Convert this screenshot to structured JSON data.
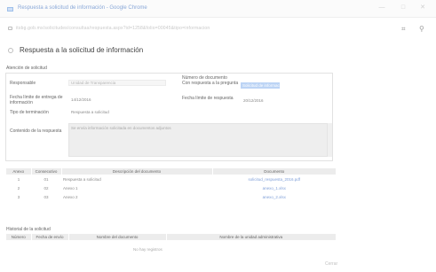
{
  "window": {
    "title": "Respuesta a solicitud de información - Google Chrome",
    "minimize_glyph": "—",
    "maximize_glyph": "□",
    "close_glyph": "✕"
  },
  "addressbar": {
    "url": "itsbg.gob.mx/solicitudes/consultas/respuesta.aspx?id=1258&folio=00045&tipo=informacion",
    "icons": [
      "lock-icon",
      "translate-icon",
      "zoom-icon"
    ]
  },
  "page": {
    "title": "Respuesta a la solicitud de información"
  },
  "request_section": {
    "label": "Atención de solicitud",
    "fields": [
      {
        "label": "Responsable",
        "value": "Unidad de Transparencia"
      },
      {
        "label": "Número de documento",
        "value": ""
      },
      {
        "label": "Con respuesta a la pregunta",
        "value": "Solicitud de información"
      },
      {
        "label": "Fecha límite de entrega de información",
        "value": "14/12/2016"
      },
      {
        "label": "Fecha límite de respuesta",
        "value": "20/12/2016"
      },
      {
        "label": "Tipo de terminación",
        "value": "Respuesta a solicitud"
      },
      {
        "label": "Contenido de la respuesta",
        "value": "Se envía información solicitada en documentos adjuntos"
      }
    ]
  },
  "attachments_table": {
    "headers": [
      "Anexo",
      "Consecutivo",
      "Descripción del documento",
      "Documento"
    ],
    "rows": [
      {
        "anexo": "1",
        "consecutivo": "01",
        "descripcion": "Respuesta a solicitud",
        "documento": "solicitud_respuesta_2016.pdf"
      },
      {
        "anexo": "2",
        "consecutivo": "02",
        "descripcion": "Anexo 1",
        "documento": "anexo_1.xlsx"
      },
      {
        "anexo": "3",
        "consecutivo": "03",
        "descripcion": "Anexo 2",
        "documento": "anexo_2.xlsx"
      }
    ]
  },
  "history_section": {
    "label": "Historial de la solicitud",
    "headers": [
      "Número",
      "Fecha de envío",
      "Nombre del documento",
      "Nombre de la unidad administrativa"
    ],
    "empty_message": "No hay registros"
  },
  "footer": {
    "label": "Cerrar"
  }
}
